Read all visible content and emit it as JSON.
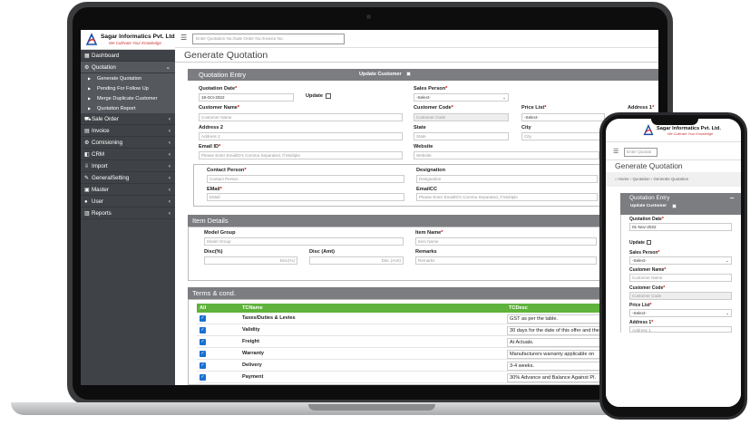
{
  "brand": {
    "name": "Sagar Informatics Pvt. Ltd.",
    "tagline": "We Cultivate Your Knowledge"
  },
  "topbar": {
    "search_placeholder": "Enter Quotation No./Sale Order No./Invoice No."
  },
  "sidebar": {
    "items": [
      {
        "label": "Dashboard",
        "icon": "dashboard-icon"
      },
      {
        "label": "Quotation",
        "icon": "gear-icon"
      },
      {
        "label": "Sale Order",
        "icon": "cart-icon"
      },
      {
        "label": "Invoice",
        "icon": "invoice-icon"
      },
      {
        "label": "Comisioning",
        "icon": "gear-icon"
      },
      {
        "label": "CRM",
        "icon": "crm-icon"
      },
      {
        "label": "Import",
        "icon": "import-icon"
      },
      {
        "label": "GeneralSetting",
        "icon": "wrench-icon"
      },
      {
        "label": "Master",
        "icon": "master-icon"
      },
      {
        "label": "User",
        "icon": "user-icon"
      },
      {
        "label": "Reports",
        "icon": "reports-icon"
      }
    ],
    "quotation_sub": [
      "Generate Quotation",
      "Pending For Follow Up",
      "Merge Duplicate Customer",
      "Quotation Report"
    ]
  },
  "page": {
    "title": "Generate Quotation"
  },
  "quotation": {
    "header": "Quotation Entry",
    "update_customer": "Update Customer",
    "date_label": "Quotation Date",
    "date_value": "19-Oct-2022",
    "update_label": "Update",
    "sales_person_label": "Sales Person",
    "sales_person_value": "-Select-",
    "customer_name_label": "Customer Name",
    "customer_name_placeholder": "Customer Name",
    "customer_code_label": "Customer Code",
    "customer_code_placeholder": "Customer Code",
    "price_list_label": "Price List",
    "price_list_value": "-Select-",
    "address1_label": "Address 1",
    "address2_label": "Address 2",
    "address2_placeholder": "Address 2",
    "state_label": "State",
    "state_placeholder": "State",
    "city_label": "City",
    "city_placeholder": "City",
    "email_label": "Email ID",
    "email_placeholder": "Please Enter EmailID's Comma Separated, If Multiple",
    "website_label": "Website",
    "website_placeholder": "Website",
    "contact_person_label": "Contact Person",
    "contact_person_placeholder": "Contact Person",
    "designation_label": "Designation",
    "designation_placeholder": "Designation",
    "email2_label": "EMail",
    "email2_placeholder": "EMail",
    "emailcc_label": "EmailCC",
    "emailcc_placeholder": "Please Enter EmailID's Comma Separated, If Multiple"
  },
  "item_details": {
    "header": "Item Details",
    "model_group_label": "Model Group",
    "model_group_placeholder": "Model Group",
    "item_name_label": "Item Name",
    "item_name_placeholder": "Item Name",
    "disc_pct_label": "Disc(%)",
    "disc_pct_placeholder": "Disc(%)",
    "disc_amt_label": "Disc (Amt)",
    "disc_amt_placeholder": "Disc (Amt)",
    "remarks_label": "Remarks",
    "remarks_placeholder": "Remarks"
  },
  "terms": {
    "header": "Terms & cond.",
    "columns": [
      "All",
      "TCName",
      "TCDesc"
    ],
    "rows": [
      {
        "name": "Taxes/Duties & Levies",
        "desc": "GST as per the table."
      },
      {
        "name": "Validity",
        "desc": "30 days for the date of this offer and the"
      },
      {
        "name": "Freight",
        "desc": "At Actuals."
      },
      {
        "name": "Warranty",
        "desc": "Manufacturers warranty applicable on"
      },
      {
        "name": "Delivery",
        "desc": "3-4 weeks."
      },
      {
        "name": "Payment",
        "desc": "30% Advance and Balance Against PI."
      }
    ]
  },
  "phone": {
    "search_placeholder": "Enter Quotati",
    "title": "Generate Quotation",
    "breadcrumb": [
      "Home",
      "Quotation",
      "Generate Quotation"
    ],
    "header": "Quotation Entry",
    "collapse": "–",
    "update_customer": "Update Customer",
    "date_label": "Quotation Date",
    "date_value": "01-Nov-2022",
    "update_label": "Update",
    "sales_person_label": "Sales Person",
    "sales_person_value": "-Select-",
    "customer_name_label": "Customer Name",
    "customer_name_placeholder": "Customer Name",
    "customer_code_label": "Customer Code",
    "customer_code_placeholder": "Customer Code",
    "price_list_label": "Price List",
    "price_list_value": "-Select-",
    "address1_label": "Address 1",
    "address1_placeholder": "Address 1"
  },
  "colors": {
    "sidebar": "#3f4246",
    "panel_header": "#7b7d80",
    "table_header": "#5fb33c",
    "checkbox": "#1a6fd1"
  }
}
